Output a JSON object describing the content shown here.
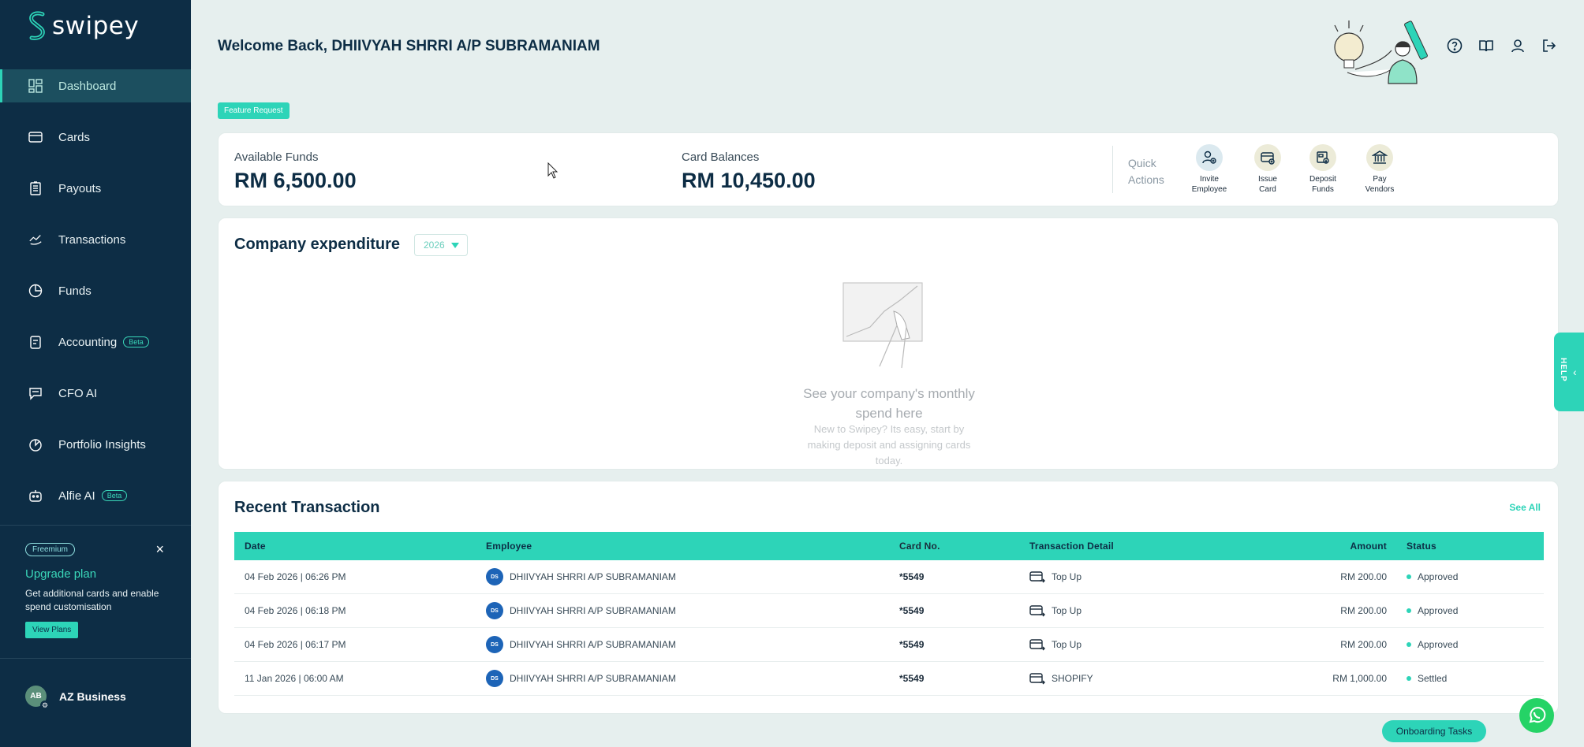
{
  "app": {
    "brand": "swipey"
  },
  "sidebar": {
    "items": [
      {
        "label": "Dashboard",
        "icon": "dashboard-icon"
      },
      {
        "label": "Cards",
        "icon": "card-icon"
      },
      {
        "label": "Payouts",
        "icon": "payouts-icon"
      },
      {
        "label": "Transactions",
        "icon": "transactions-icon"
      },
      {
        "label": "Funds",
        "icon": "pie-chart-icon"
      },
      {
        "label": "Accounting",
        "icon": "accounting-icon",
        "badge": "Beta"
      },
      {
        "label": "CFO AI",
        "icon": "chat-icon"
      },
      {
        "label": "Portfolio Insights",
        "icon": "insights-icon"
      },
      {
        "label": "Alfie AI",
        "icon": "robot-icon",
        "badge": "Beta"
      }
    ],
    "upgrade": {
      "plan_badge": "Freemium",
      "title": "Upgrade plan",
      "description": "Get additional cards and enable spend customisation",
      "button": "View Plans",
      "close": "×"
    },
    "account": {
      "initials": "AB",
      "name": "AZ Business"
    }
  },
  "header": {
    "welcome": "Welcome Back, DHIIVYAH SHRRI A/P SUBRAMANIAM",
    "feature_request": "Feature Request"
  },
  "funds": {
    "available_label": "Available Funds",
    "available_value": "RM 6,500.00",
    "balances_label": "Card Balances",
    "balances_value": "RM 10,450.00",
    "quick_actions_title": "Quick Actions",
    "quick_actions": [
      {
        "line1": "Invite",
        "line2": "Employee"
      },
      {
        "line1": "Issue",
        "line2": "Card"
      },
      {
        "line1": "Deposit",
        "line2": "Funds"
      },
      {
        "line1": "Pay",
        "line2": "Vendors"
      }
    ]
  },
  "expenditure": {
    "title": "Company expenditure",
    "year": "2026",
    "empty_title_1": "See your company's monthly",
    "empty_title_2": "spend here",
    "empty_sub_1": "New to Swipey? Its easy, start by",
    "empty_sub_2": "making deposit and assigning cards",
    "empty_sub_3": "today."
  },
  "recent": {
    "title": "Recent Transaction",
    "see_all": "See All",
    "columns": {
      "date": "Date",
      "employee": "Employee",
      "card": "Card No.",
      "detail": "Transaction Detail",
      "amount": "Amount",
      "status": "Status"
    },
    "rows": [
      {
        "date": "04 Feb 2026 | 06:26 PM",
        "initials": "DS",
        "employee": "DHIIVYAH SHRRI A/P SUBRAMANIAM",
        "card": "*5549",
        "detail": "Top Up",
        "amount": "RM 200.00",
        "status": "Approved"
      },
      {
        "date": "04 Feb 2026 | 06:18 PM",
        "initials": "DS",
        "employee": "DHIIVYAH SHRRI A/P SUBRAMANIAM",
        "card": "*5549",
        "detail": "Top Up",
        "amount": "RM 200.00",
        "status": "Approved"
      },
      {
        "date": "04 Feb 2026 | 06:17 PM",
        "initials": "DS",
        "employee": "DHIIVYAH SHRRI A/P SUBRAMANIAM",
        "card": "*5549",
        "detail": "Top Up",
        "amount": "RM 200.00",
        "status": "Approved"
      },
      {
        "date": "11 Jan 2026 | 06:00 AM",
        "initials": "DS",
        "employee": "DHIIVYAH SHRRI A/P SUBRAMANIAM",
        "card": "*5549",
        "detail": "SHOPIFY",
        "amount": "RM 1,000.00",
        "status": "Settled"
      }
    ]
  },
  "floating": {
    "help": "HELP",
    "onboarding": "Onboarding Tasks"
  },
  "colors": {
    "sidebar": "#0d2d45",
    "accent": "#2dd4b8",
    "background": "#e6efee"
  }
}
